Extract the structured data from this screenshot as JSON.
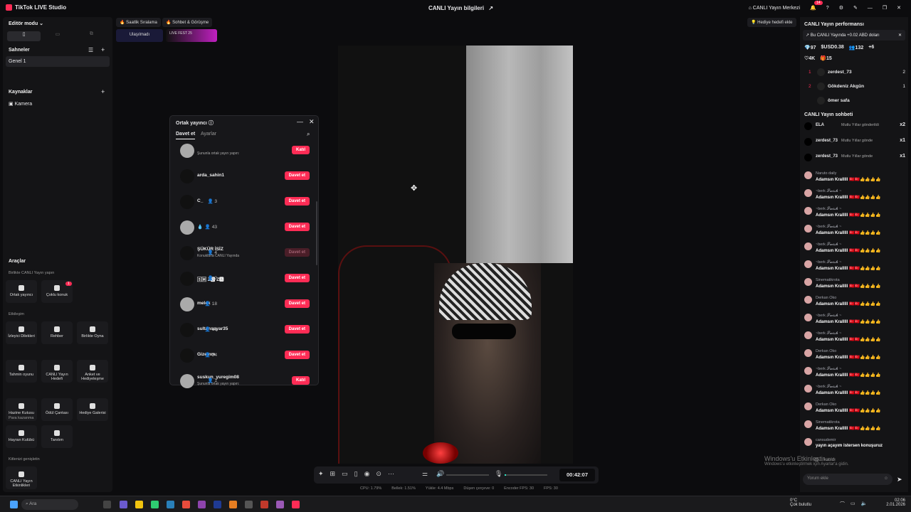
{
  "titlebar": {
    "app_name": "TikTok LIVE Studio",
    "center_title": "CANLI Yayın bilgileri",
    "live_center": "CANLI Yayın Merkezi",
    "notif_count": "14"
  },
  "left": {
    "editor_mode": "Editör modu",
    "scenes_title": "Sahneler",
    "scene_item": "Genel 1",
    "sources_title": "Kaynaklar",
    "source_item": "Kamera",
    "tools_title": "Araçlar",
    "group1": "Birlikte CANLI Yayın yapın",
    "tools1": [
      {
        "label": "Ortak yayıncı"
      },
      {
        "label": "Çoklu konuk",
        "badge": "1"
      }
    ],
    "group2": "Etkileşim",
    "tools2": [
      {
        "label": "İzleyici Dilekleri"
      },
      {
        "label": "Rehber"
      },
      {
        "label": "Birlikte Oyna"
      },
      {
        "label": "Tahmin oyunu"
      },
      {
        "label": "CANLI Yayın Hedefi"
      },
      {
        "label": "Anket ve Hediyeleşme"
      },
      {
        "label": "Hazine Kutusu"
      },
      {
        "label": "Ödül Çantası"
      },
      {
        "label": "Hediye Galerisi"
      }
    ],
    "group3": "Para kazanma",
    "tools3": [
      {
        "label": "Hayran Kulübü"
      },
      {
        "label": "Tanıtım"
      }
    ],
    "group4": "Kitlenizi genişletin",
    "tools4": [
      {
        "label": "CANLI Yayın Etkinlikleri"
      }
    ]
  },
  "top_chips": {
    "chip1": "Saatlik Sıralama",
    "chip2": "Sohbet & Görüşme",
    "chip3": "Ulaşılmadı",
    "chip4": "LIVE FEST 25",
    "gift_goal": "Hediye hedefi ekle"
  },
  "modal": {
    "title": "Ortak yayıncı",
    "tab_invite": "Davet et",
    "tab_settings": "Ayarlar",
    "rows": [
      {
        "name": "",
        "count": "",
        "sub": "Şununla ortak yayın yapın:",
        "button": "Katıl",
        "disabled": false
      },
      {
        "name": "arda_sahin1",
        "count": "",
        "sub": "",
        "button": "Davet et",
        "disabled": false
      },
      {
        "name": "C_",
        "count": "3",
        "sub": "",
        "button": "Davet et",
        "disabled": false
      },
      {
        "name": "💧",
        "count": "43",
        "sub": "",
        "button": "Davet et",
        "disabled": false
      },
      {
        "name": "ŞÜKÜR İSİZ",
        "count": "4",
        "sub": "Konuklarla CANLI Yayında",
        "button": "Davet et",
        "disabled": true
      },
      {
        "name": "🅂🄼 Z🅾 Z🅰",
        "count": "2",
        "sub": "",
        "button": "Davet et",
        "disabled": false
      },
      {
        "name": "melek",
        "count": "18",
        "sub": "",
        "button": "Davet et",
        "disabled": false
      },
      {
        "name": "sultansayar35",
        "count": "15",
        "sub": "",
        "button": "Davet et",
        "disabled": false
      },
      {
        "name": "Gizemm",
        "count": "24",
        "sub": "",
        "button": "Davet et",
        "disabled": false
      },
      {
        "name": "suskun_yuregim08",
        "count": "1",
        "sub": "Şununla ortak yayın yapın:",
        "button": "Katıl",
        "disabled": false
      }
    ]
  },
  "controls": {
    "timer": "00:42:07"
  },
  "stats": {
    "cpu": "CPU: 1.79%",
    "memory": "Bellek: 1.51%",
    "upload": "Yükle: 4.4 Mbps",
    "dropped": "Düşen çerçeve: 0",
    "encoder": "Encoder FPS: 30",
    "fps": "FPS: 30"
  },
  "right": {
    "perf_title": "CANLI Yayın performansı",
    "perf_banner": "Bu CANLI Yayında +0.02 ABD doları",
    "metrics": {
      "diamonds": "97",
      "usd": "USD0.38",
      "viewers": "132",
      "follows": "6",
      "likes": "4K",
      "gifts": "15"
    },
    "ranking": [
      {
        "rank": "1",
        "name": "zerdest_73",
        "val": "2"
      },
      {
        "rank": "2",
        "name": "Gökdeniz Akgün",
        "val": "1"
      },
      {
        "rank": "",
        "name": "ömer safa",
        "val": ""
      }
    ],
    "chat_title": "CANLI Yayın sohbeti",
    "gifts": [
      {
        "name": "ELA",
        "text": "Mutlu Yıllar gönderildi",
        "mult": "x2"
      },
      {
        "name": "zerdest_73",
        "text": "Mutlu Yıllar gönde",
        "mult": "x1"
      },
      {
        "name": "zerdest_73",
        "text": "Mutlu Yıllar gönde",
        "mult": "x1"
      }
    ],
    "chat": [
      {
        "name": "Naruto daily",
        "msg": "Adamsın Kralllll 🇹🇷🇹🇷👍👍👍👍"
      },
      {
        "name": "~berk 𝓢𝔀𝓲𝓼𝓱 ~",
        "msg": "Adamsın Kralllll 🇹🇷🇹🇷👍👍👍👍"
      },
      {
        "name": "~berk 𝓢𝔀𝓲𝓼𝓱 ~",
        "msg": "Adamsın Kralllll 🇹🇷🇹🇷👍👍👍👍"
      },
      {
        "name": "~berk 𝓢𝔀𝓲𝓼𝓱 ~",
        "msg": "Adamsın Kralllll 🇹🇷🇹🇷👍👍👍👍"
      },
      {
        "name": "~berk 𝓢𝔀𝓲𝓼𝓱 ~",
        "msg": "Adamsın Kralllll 🇹🇷🇹🇷👍👍👍👍"
      },
      {
        "name": "~berk 𝓢𝔀𝓲𝓼𝓱 ~",
        "msg": "Adamsın Kralllll 🇹🇷🇹🇷👍👍👍👍"
      },
      {
        "name": "Sinematikrota",
        "msg": "Adamsın Kralllll 🇹🇷🇹🇷👍👍👍👍"
      },
      {
        "name": "Derkan Oko",
        "msg": "Adamsın Kralllll 🇹🇷🇹🇷👍👍👍👍"
      },
      {
        "name": "~berk 𝓢𝔀𝓲𝓼𝓱 ~",
        "msg": "Adamsın Kralllll 🇹🇷🇹🇷👍👍👍👍"
      },
      {
        "name": "~berk 𝓢𝔀𝓲𝓼𝓱 ~",
        "msg": "Adamsın Kralllll 🇹🇷🇹🇷👍👍👍👍"
      },
      {
        "name": "Derkan Oko",
        "msg": "Adamsın Kralllll 🇹🇷🇹🇷👍👍👍👍"
      },
      {
        "name": "~berk 𝓢𝔀𝓲𝓼𝓱 ~",
        "msg": "Adamsın Kralllll 🇹🇷🇹🇷👍👍👍👍"
      },
      {
        "name": "~berk 𝓢𝔀𝓲𝓼𝓱 ~",
        "msg": "Adamsın Kralllll 🇹🇷🇹🇷👍👍👍👍"
      },
      {
        "name": "Derkan Oko",
        "msg": "Adamsın Kralllll 🇹🇷🇹🇷👍👍👍👍"
      },
      {
        "name": "Sinematikrota",
        "msg": "Adamsın Kralllll 🇹🇷🇹🇷👍👍👍👍"
      },
      {
        "name": "cansudemir",
        "msg": "yayın açayım istersen konuşuruz"
      }
    ],
    "joined": "katıldı",
    "comment_placeholder": "Yorum ekle"
  },
  "watermark": {
    "line1": "Windows'u Etkinleştir",
    "line2": "Windows'u etkinleştirmek için Ayarlar'a gidin."
  },
  "taskbar": {
    "search": "Ara",
    "weather_temp": "0°C",
    "weather_desc": "Çok bulutlu",
    "time": "02:06",
    "date": "2.01.2026"
  }
}
